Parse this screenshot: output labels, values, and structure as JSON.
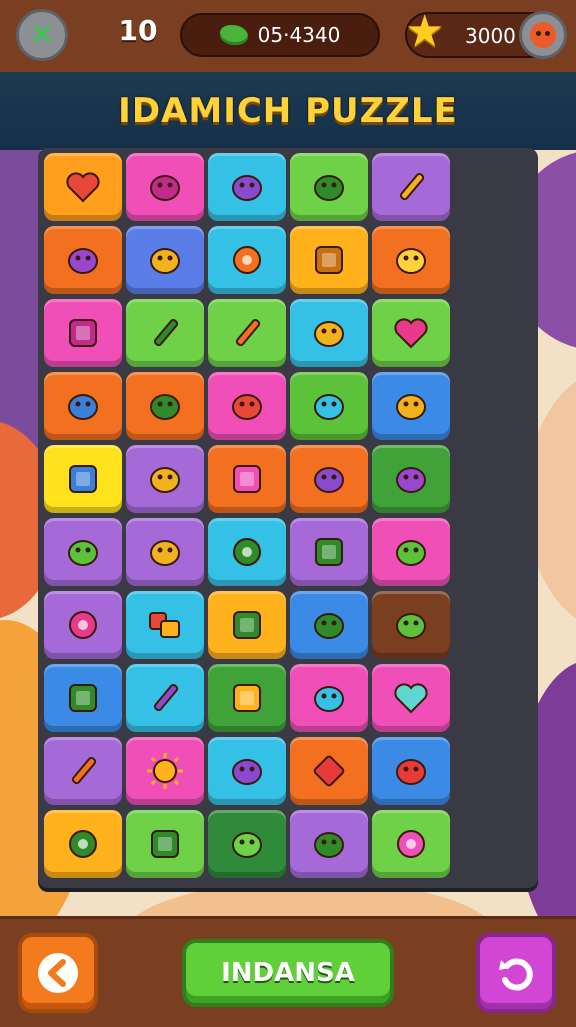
{
  "header": {
    "level": "10",
    "timer": "05·4340",
    "coins": "3000",
    "close_icon": "close-icon",
    "timer_icon": "blob-icon",
    "star_icon": "star-icon",
    "profile_icon": "face-icon"
  },
  "title": "IDAMICH PUZZLE",
  "board": {
    "columns": 5,
    "rows": 10,
    "tiles": [
      {
        "color": "#ff9f1c",
        "icon": "heart-face",
        "glyph": "#e8483a"
      },
      {
        "color": "#f04fb8",
        "icon": "bug",
        "glyph": "#c22a8e"
      },
      {
        "color": "#35c0e6",
        "icon": "critter",
        "glyph": "#8a4ad0"
      },
      {
        "color": "#6fd147",
        "icon": "frog",
        "glyph": "#2f8a2a"
      },
      {
        "color": "#a56ad8",
        "icon": "pencil",
        "glyph": "#f2b21e"
      },
      {
        "color": "#f2701f",
        "icon": "mushroom",
        "glyph": "#9b46d0"
      },
      {
        "color": "#5b7de8",
        "icon": "key",
        "glyph": "#f2b21e"
      },
      {
        "color": "#35c0e6",
        "icon": "donut",
        "glyph": "#f2701f"
      },
      {
        "color": "#ffb21c",
        "icon": "frame",
        "glyph": "#c9700e"
      },
      {
        "color": "#f2701f",
        "icon": "creature",
        "glyph": "#ffd23a"
      },
      {
        "color": "#f04fb8",
        "icon": "camera",
        "glyph": "#c22a8e"
      },
      {
        "color": "#6fd147",
        "icon": "pencil",
        "glyph": "#2f8a2a"
      },
      {
        "color": "#6fd147",
        "icon": "brush",
        "glyph": "#f2701f"
      },
      {
        "color": "#35c0e6",
        "icon": "mushroom",
        "glyph": "#f2b21e"
      },
      {
        "color": "#6fd147",
        "icon": "heart",
        "glyph": "#e83a8a"
      },
      {
        "color": "#f2701f",
        "icon": "boot",
        "glyph": "#3a7fd8"
      },
      {
        "color": "#f2701f",
        "icon": "fish",
        "glyph": "#2f8a2a"
      },
      {
        "color": "#f04fb8",
        "icon": "cross-tools",
        "glyph": "#e8483a"
      },
      {
        "color": "#5bc23a",
        "icon": "gem",
        "glyph": "#35c0e6"
      },
      {
        "color": "#3a8ae6",
        "icon": "plane",
        "glyph": "#f2b21e"
      },
      {
        "color": "#ffe21c",
        "icon": "box",
        "glyph": "#3a7fd8"
      },
      {
        "color": "#a56ad8",
        "icon": "creature",
        "glyph": "#f2b21e"
      },
      {
        "color": "#f2701f",
        "icon": "book",
        "glyph": "#f04fb8"
      },
      {
        "color": "#f2701f",
        "icon": "wrench",
        "glyph": "#8a4ad0"
      },
      {
        "color": "#3fa33a",
        "icon": "berry",
        "glyph": "#9b46d0"
      },
      {
        "color": "#a56ad8",
        "icon": "leaf",
        "glyph": "#5bc23a"
      },
      {
        "color": "#a56ad8",
        "icon": "candy",
        "glyph": "#f2b21e"
      },
      {
        "color": "#35c0e6",
        "icon": "ring",
        "glyph": "#2f8a2a"
      },
      {
        "color": "#a56ad8",
        "icon": "envelope",
        "glyph": "#2f8a2a"
      },
      {
        "color": "#f04fb8",
        "icon": "rocket",
        "glyph": "#5bc23a"
      },
      {
        "color": "#a56ad8",
        "icon": "ring",
        "glyph": "#e83a8a"
      },
      {
        "color": "#35c0e6",
        "icon": "squares",
        "glyph": "#ffb21c"
      },
      {
        "color": "#ffb21c",
        "icon": "phone",
        "glyph": "#2f8a2a"
      },
      {
        "color": "#3a8ae6",
        "icon": "blob",
        "glyph": "#2f8a2a"
      },
      {
        "color": "#7a3e20",
        "icon": "arrow",
        "glyph": "#5bc23a"
      },
      {
        "color": "#3a8ae6",
        "icon": "leaf-box",
        "glyph": "#2f8a2a"
      },
      {
        "color": "#35c0e6",
        "icon": "pencil",
        "glyph": "#8a4ad0"
      },
      {
        "color": "#3fa33a",
        "icon": "folder",
        "glyph": "#ffb21c"
      },
      {
        "color": "#f04fb8",
        "icon": "bubble",
        "glyph": "#35c0e6"
      },
      {
        "color": "#f04fb8",
        "icon": "heart",
        "glyph": "#5fd6d0"
      },
      {
        "color": "#a56ad8",
        "icon": "match",
        "glyph": "#f2701f"
      },
      {
        "color": "#f04fb8",
        "icon": "sun",
        "glyph": "#ffb21c"
      },
      {
        "color": "#35c0e6",
        "icon": "mic",
        "glyph": "#8a4ad0"
      },
      {
        "color": "#f2701f",
        "icon": "diamond",
        "glyph": "#e83a3a"
      },
      {
        "color": "#3a8ae6",
        "icon": "apple",
        "glyph": "#e83a3a"
      },
      {
        "color": "#ffb21c",
        "icon": "ring",
        "glyph": "#2f8a2a"
      },
      {
        "color": "#6fd147",
        "icon": "face-box",
        "glyph": "#2f8a2a"
      },
      {
        "color": "#2f8a3a",
        "icon": "blob",
        "glyph": "#6fd147"
      },
      {
        "color": "#a56ad8",
        "icon": "pill",
        "glyph": "#2f8a2a"
      },
      {
        "color": "#6fd147",
        "icon": "target",
        "glyph": "#f04fb8"
      }
    ]
  },
  "footer": {
    "back_icon": "back-arrow-icon",
    "main_label": "INDANSA",
    "undo_icon": "undo-icon"
  }
}
